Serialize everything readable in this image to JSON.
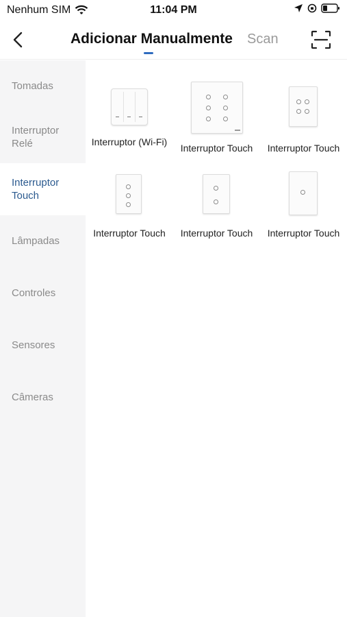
{
  "status": {
    "carrier": "Nenhum SIM",
    "time": "11:04 PM"
  },
  "nav": {
    "title": "Adicionar Manualmente",
    "scan_label": "Scan",
    "accent": "#2f6bbf"
  },
  "sidebar": {
    "items": [
      {
        "label": "Tomadas",
        "active": false
      },
      {
        "label": "Interruptor Relé",
        "active": false
      },
      {
        "label": "Interruptor Touch",
        "active": true
      },
      {
        "label": "Lâmpadas",
        "active": false
      },
      {
        "label": "Controles",
        "active": false
      },
      {
        "label": "Sensores",
        "active": false
      },
      {
        "label": "Câmeras",
        "active": false
      }
    ],
    "active_color": "#2b5a8f"
  },
  "products": [
    {
      "label": "Interruptor (Wi-Fi)",
      "icon": "wifi-switch-3-gang"
    },
    {
      "label": "Interruptor Touch",
      "icon": "touch-switch-6-gang"
    },
    {
      "label": "Interruptor Touch",
      "icon": "touch-switch-4-gang"
    },
    {
      "label": "Interruptor Touch",
      "icon": "touch-switch-3-gang"
    },
    {
      "label": "Interruptor Touch",
      "icon": "touch-switch-2-gang"
    },
    {
      "label": "Interruptor Touch",
      "icon": "touch-switch-1-gang"
    }
  ]
}
